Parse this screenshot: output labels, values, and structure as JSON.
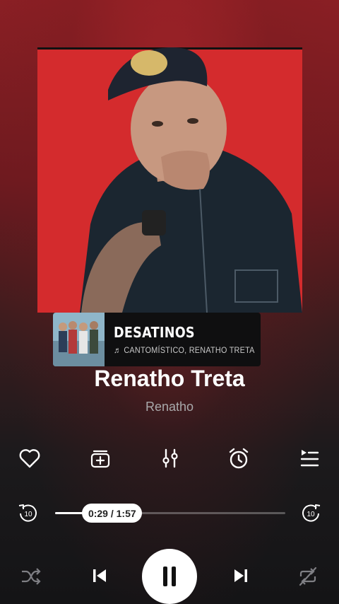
{
  "player": {
    "colors": {
      "background_top": "#8a1f24",
      "background_bottom": "#141416",
      "accent": "#ffffff"
    }
  },
  "now_playing_card": {
    "title": "DESATINOS",
    "subtitle": "♬ CANTOMÍSTICO, RENATHO TRETA"
  },
  "track": {
    "title": "Renatho Treta",
    "artist": "Renatho"
  },
  "actions": [
    {
      "icon": "heart-icon"
    },
    {
      "icon": "add-to-playlist-icon"
    },
    {
      "icon": "equalizer-icon"
    },
    {
      "icon": "sleep-timer-icon"
    },
    {
      "icon": "queue-icon"
    }
  ],
  "progress": {
    "time_label": "0:29 / 1:57",
    "current_seconds": 29,
    "total_seconds": 117,
    "rewind_label": "10",
    "forward_label": "10"
  },
  "controls": {
    "shuffle_icon": "shuffle-icon",
    "previous_icon": "skip-previous-icon",
    "play_pause_icon": "pause-icon",
    "next_icon": "skip-next-icon",
    "repeat_icon": "repeat-off-icon"
  }
}
